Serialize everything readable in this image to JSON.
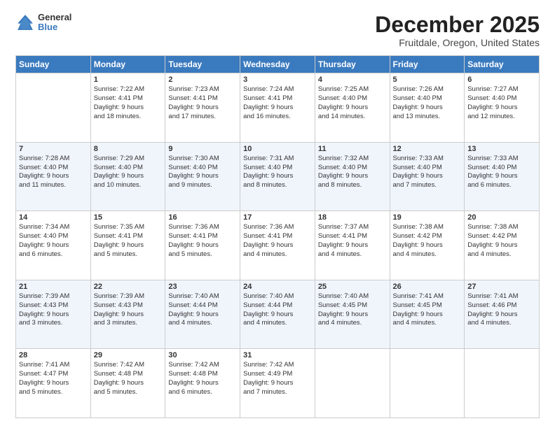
{
  "header": {
    "logo": {
      "general": "General",
      "blue": "Blue"
    },
    "title": "December 2025",
    "location": "Fruitdale, Oregon, United States"
  },
  "days_of_week": [
    "Sunday",
    "Monday",
    "Tuesday",
    "Wednesday",
    "Thursday",
    "Friday",
    "Saturday"
  ],
  "weeks": [
    [
      {
        "day": "",
        "sunrise": "",
        "sunset": "",
        "daylight": "",
        "empty": true
      },
      {
        "day": "1",
        "sunrise": "7:22 AM",
        "sunset": "4:41 PM",
        "daylight": "9 hours and 18 minutes."
      },
      {
        "day": "2",
        "sunrise": "7:23 AM",
        "sunset": "4:41 PM",
        "daylight": "9 hours and 17 minutes."
      },
      {
        "day": "3",
        "sunrise": "7:24 AM",
        "sunset": "4:41 PM",
        "daylight": "9 hours and 16 minutes."
      },
      {
        "day": "4",
        "sunrise": "7:25 AM",
        "sunset": "4:40 PM",
        "daylight": "9 hours and 14 minutes."
      },
      {
        "day": "5",
        "sunrise": "7:26 AM",
        "sunset": "4:40 PM",
        "daylight": "9 hours and 13 minutes."
      },
      {
        "day": "6",
        "sunrise": "7:27 AM",
        "sunset": "4:40 PM",
        "daylight": "9 hours and 12 minutes."
      }
    ],
    [
      {
        "day": "7",
        "sunrise": "7:28 AM",
        "sunset": "4:40 PM",
        "daylight": "9 hours and 11 minutes."
      },
      {
        "day": "8",
        "sunrise": "7:29 AM",
        "sunset": "4:40 PM",
        "daylight": "9 hours and 10 minutes."
      },
      {
        "day": "9",
        "sunrise": "7:30 AM",
        "sunset": "4:40 PM",
        "daylight": "9 hours and 9 minutes."
      },
      {
        "day": "10",
        "sunrise": "7:31 AM",
        "sunset": "4:40 PM",
        "daylight": "9 hours and 8 minutes."
      },
      {
        "day": "11",
        "sunrise": "7:32 AM",
        "sunset": "4:40 PM",
        "daylight": "9 hours and 8 minutes."
      },
      {
        "day": "12",
        "sunrise": "7:33 AM",
        "sunset": "4:40 PM",
        "daylight": "9 hours and 7 minutes."
      },
      {
        "day": "13",
        "sunrise": "7:33 AM",
        "sunset": "4:40 PM",
        "daylight": "9 hours and 6 minutes."
      }
    ],
    [
      {
        "day": "14",
        "sunrise": "7:34 AM",
        "sunset": "4:40 PM",
        "daylight": "9 hours and 6 minutes."
      },
      {
        "day": "15",
        "sunrise": "7:35 AM",
        "sunset": "4:41 PM",
        "daylight": "9 hours and 5 minutes."
      },
      {
        "day": "16",
        "sunrise": "7:36 AM",
        "sunset": "4:41 PM",
        "daylight": "9 hours and 5 minutes."
      },
      {
        "day": "17",
        "sunrise": "7:36 AM",
        "sunset": "4:41 PM",
        "daylight": "9 hours and 4 minutes."
      },
      {
        "day": "18",
        "sunrise": "7:37 AM",
        "sunset": "4:41 PM",
        "daylight": "9 hours and 4 minutes."
      },
      {
        "day": "19",
        "sunrise": "7:38 AM",
        "sunset": "4:42 PM",
        "daylight": "9 hours and 4 minutes."
      },
      {
        "day": "20",
        "sunrise": "7:38 AM",
        "sunset": "4:42 PM",
        "daylight": "9 hours and 4 minutes."
      }
    ],
    [
      {
        "day": "21",
        "sunrise": "7:39 AM",
        "sunset": "4:43 PM",
        "daylight": "9 hours and 3 minutes."
      },
      {
        "day": "22",
        "sunrise": "7:39 AM",
        "sunset": "4:43 PM",
        "daylight": "9 hours and 3 minutes."
      },
      {
        "day": "23",
        "sunrise": "7:40 AM",
        "sunset": "4:44 PM",
        "daylight": "9 hours and 4 minutes."
      },
      {
        "day": "24",
        "sunrise": "7:40 AM",
        "sunset": "4:44 PM",
        "daylight": "9 hours and 4 minutes."
      },
      {
        "day": "25",
        "sunrise": "7:40 AM",
        "sunset": "4:45 PM",
        "daylight": "9 hours and 4 minutes."
      },
      {
        "day": "26",
        "sunrise": "7:41 AM",
        "sunset": "4:45 PM",
        "daylight": "9 hours and 4 minutes."
      },
      {
        "day": "27",
        "sunrise": "7:41 AM",
        "sunset": "4:46 PM",
        "daylight": "9 hours and 4 minutes."
      }
    ],
    [
      {
        "day": "28",
        "sunrise": "7:41 AM",
        "sunset": "4:47 PM",
        "daylight": "9 hours and 5 minutes."
      },
      {
        "day": "29",
        "sunrise": "7:42 AM",
        "sunset": "4:48 PM",
        "daylight": "9 hours and 5 minutes."
      },
      {
        "day": "30",
        "sunrise": "7:42 AM",
        "sunset": "4:48 PM",
        "daylight": "9 hours and 6 minutes."
      },
      {
        "day": "31",
        "sunrise": "7:42 AM",
        "sunset": "4:49 PM",
        "daylight": "9 hours and 7 minutes."
      },
      {
        "day": "",
        "sunrise": "",
        "sunset": "",
        "daylight": "",
        "empty": true
      },
      {
        "day": "",
        "sunrise": "",
        "sunset": "",
        "daylight": "",
        "empty": true
      },
      {
        "day": "",
        "sunrise": "",
        "sunset": "",
        "daylight": "",
        "empty": true
      }
    ]
  ],
  "labels": {
    "sunrise": "Sunrise:",
    "sunset": "Sunset:",
    "daylight": "Daylight:"
  }
}
